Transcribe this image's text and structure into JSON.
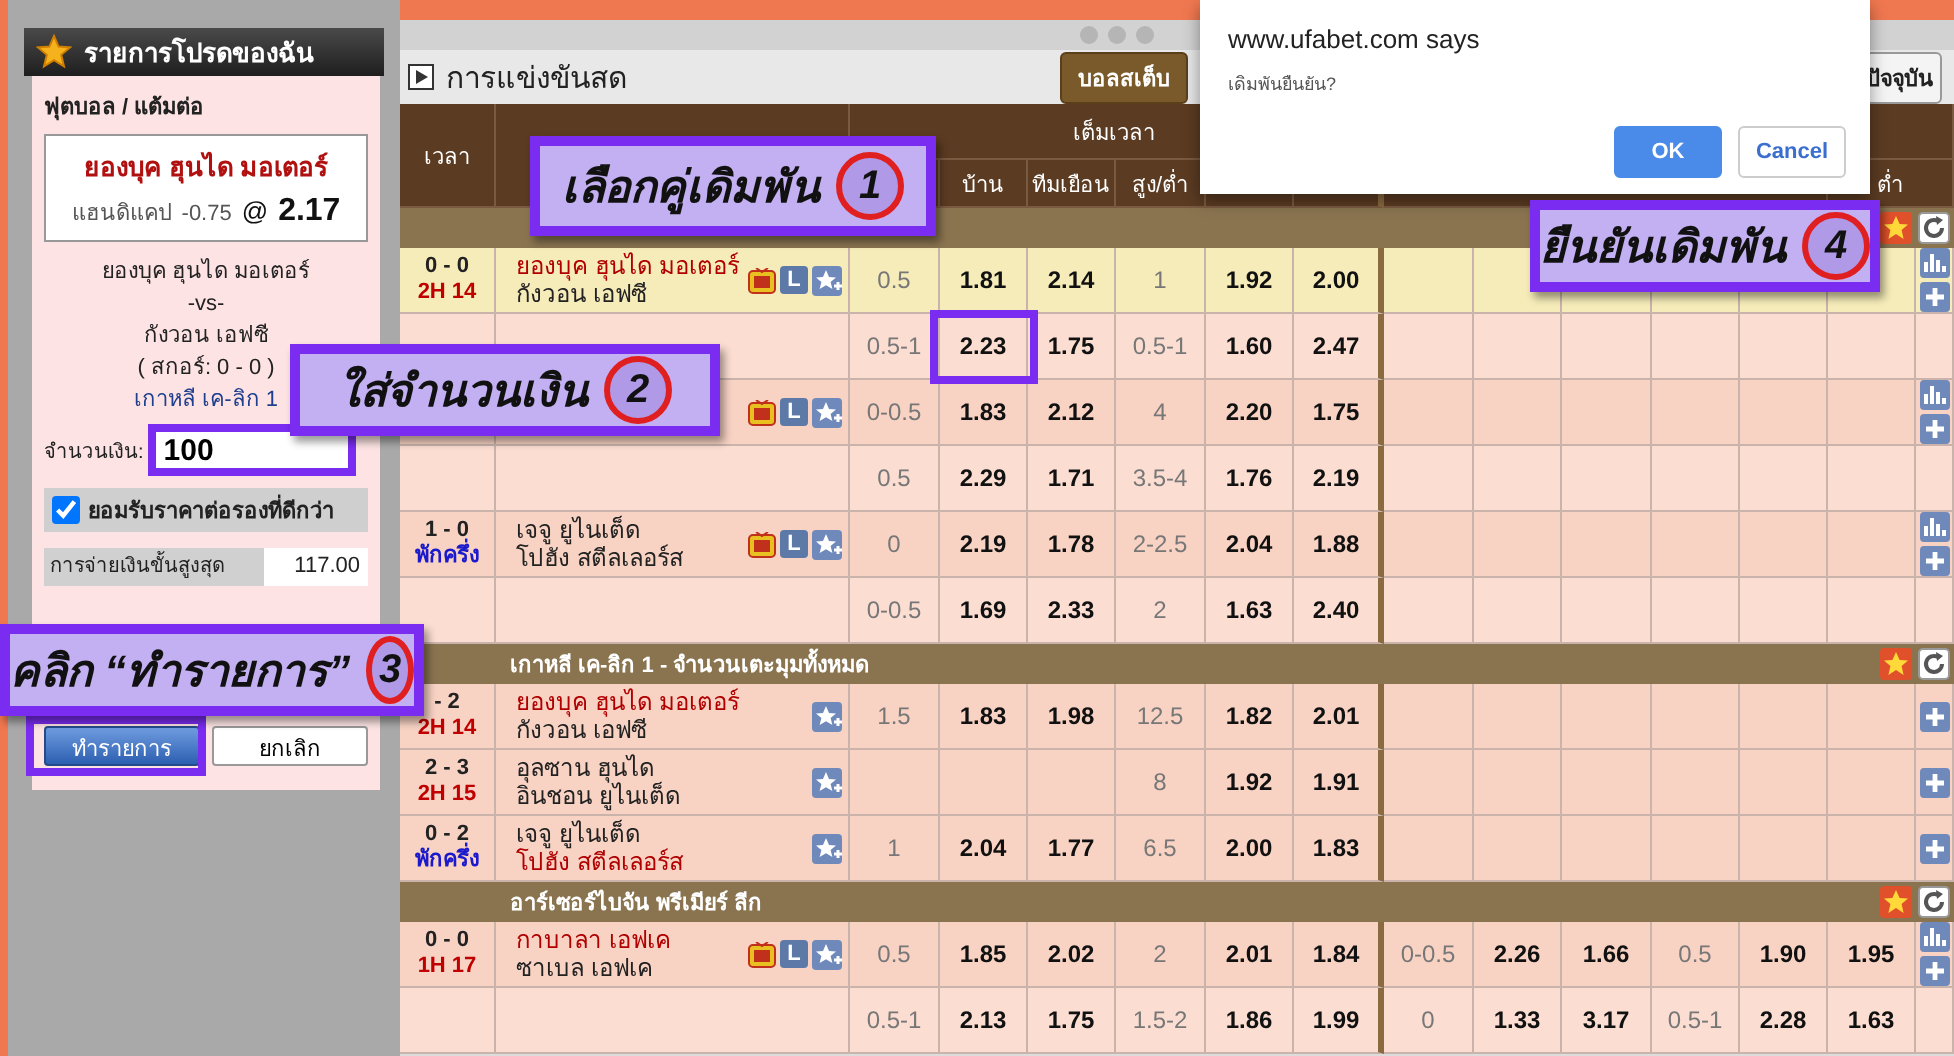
{
  "window": {
    "title": "การแข่งขันสด",
    "buttons": [
      {
        "label": "บอลสเต็บ",
        "kind": "dark"
      },
      {
        "label": "ปัจจุบัน",
        "kind": "light"
      }
    ]
  },
  "favorites": {
    "title": "รายการโปรดของฉัน",
    "sport": "ฟุตบอล / แต้มต่อ",
    "pick": {
      "team": "ยองบุค ฮุนได มอเตอร์",
      "market": "แฮนดิแคป",
      "line": "-0.75",
      "at": "@",
      "odds": "2.17"
    },
    "match_lines": [
      {
        "text": "ยองบุค ฮุนได มอเตอร์",
        "kind": "plain"
      },
      {
        "text": "-vs-",
        "kind": "plain"
      },
      {
        "text": "กังวอน เอฟซี",
        "kind": "plain"
      },
      {
        "text": "( สกอร์: 0 - 0 )",
        "kind": "plain"
      },
      {
        "text": "เกาหลี เค-ลิก 1",
        "kind": "league"
      }
    ],
    "amount": {
      "label": "จำนวนเงิน:",
      "value": "100"
    },
    "accept_better_odds": {
      "label": "ยอมรับราคาต่อรองที่ดีกว่า",
      "checked": true
    },
    "max_payout": {
      "label": "การจ่ายเงินขั้นสูงสุด",
      "value": "117.00"
    },
    "buttons": [
      {
        "label": "ทำรายการ",
        "kind": "primary"
      },
      {
        "label": "ยกเลิก",
        "kind": "secondary"
      }
    ]
  },
  "table": {
    "time_header": "เวลา",
    "full_time_header": "เต็มเวลา",
    "full_time_subheaders": [
      "บ้าน",
      "ทีมเยือน",
      "สูง/ต่ำ"
    ],
    "first_half_subheaders": [
      "ต่ำ"
    ],
    "groups": [
      {
        "matches": [
          {
            "score": "0 - 0",
            "period": {
              "text": "2H 14",
              "color": "#c00000"
            },
            "highlighted": true,
            "teams": [
              {
                "name": "ยองบุค ฮุนได มอเตอร์",
                "favored": true
              },
              {
                "name": "กังวอน เอฟซี",
                "favored": false
              }
            ],
            "icons": [
              {
                "kind": "tv"
              },
              {
                "kind": "live",
                "label": "L"
              },
              {
                "kind": "favorite"
              }
            ],
            "actions": [
              {
                "kind": "chart"
              },
              {
                "kind": "plus"
              }
            ],
            "lines": [
              {
                "handicap": [
                  "0.5",
                  "1.81",
                  "2.14"
                ],
                "over_under": [
                  "1",
                  "1.92",
                  "2.00"
                ]
              },
              {
                "handicap": [
                  "0.5-1",
                  "2.23",
                  "1.75"
                ],
                "over_under": [
                  "0.5-1",
                  "1.60",
                  "2.47"
                ]
              }
            ]
          },
          {
            "highlighted": false,
            "icons": [
              {
                "kind": "tv"
              },
              {
                "kind": "live",
                "label": "L"
              },
              {
                "kind": "favorite"
              }
            ],
            "actions": [
              {
                "kind": "chart"
              },
              {
                "kind": "plus"
              }
            ],
            "lines": [
              {
                "handicap": [
                  "0-0.5",
                  "1.83",
                  "2.12"
                ],
                "over_under": [
                  "4",
                  "2.20",
                  "1.75"
                ]
              },
              {
                "handicap": [
                  "0.5",
                  "2.29",
                  "1.71"
                ],
                "over_under": [
                  "3.5-4",
                  "1.76",
                  "2.19"
                ]
              }
            ]
          },
          {
            "score": "1 - 0",
            "period": {
              "text": "พักครึ่ง",
              "color": "#1a1acc"
            },
            "highlighted": false,
            "teams": [
              {
                "name": "เจจู ยูไนเต็ด",
                "favored": false
              },
              {
                "name": "โปฮัง สตีลเลอร์ส",
                "favored": false
              }
            ],
            "icons": [
              {
                "kind": "tv"
              },
              {
                "kind": "live",
                "label": "L"
              },
              {
                "kind": "favorite"
              }
            ],
            "actions": [
              {
                "kind": "chart"
              },
              {
                "kind": "plus"
              }
            ],
            "lines": [
              {
                "handicap": [
                  "0",
                  "2.19",
                  "1.78"
                ],
                "over_under": [
                  "2-2.5",
                  "2.04",
                  "1.88"
                ]
              },
              {
                "handicap": [
                  "0-0.5",
                  "1.69",
                  "2.33"
                ],
                "over_under": [
                  "2",
                  "1.63",
                  "2.40"
                ]
              }
            ]
          }
        ]
      },
      {
        "league": "เกาหลี เค-ลิก 1 - จำนวนเตะมุมทั้งหมด",
        "matches": [
          {
            "score": "- 2",
            "period": {
              "text": "2H 14",
              "color": "#c00000"
            },
            "highlighted": false,
            "teams": [
              {
                "name": "ยองบุค ฮุนได มอเตอร์",
                "favored": true
              },
              {
                "name": "กังวอน เอฟซี",
                "favored": false
              }
            ],
            "icons": [
              {
                "kind": "favorite"
              }
            ],
            "actions": [
              {
                "kind": "plus"
              }
            ],
            "lines": [
              {
                "handicap": [
                  "1.5",
                  "1.83",
                  "1.98"
                ],
                "over_under": [
                  "12.5",
                  "1.82",
                  "2.01"
                ]
              }
            ]
          },
          {
            "score": "2 - 3",
            "period": {
              "text": "2H 15",
              "color": "#c00000"
            },
            "highlighted": false,
            "teams": [
              {
                "name": "อุลซาน ฮุนได",
                "favored": false
              },
              {
                "name": "อินชอน ยูไนเต็ด",
                "favored": false
              }
            ],
            "icons": [
              {
                "kind": "favorite"
              }
            ],
            "actions": [
              {
                "kind": "plus"
              }
            ],
            "lines": [
              {
                "over_under": [
                  "8",
                  "1.92",
                  "1.91"
                ]
              }
            ]
          },
          {
            "score": "0 - 2",
            "period": {
              "text": "พักครึ่ง",
              "color": "#1a1acc"
            },
            "highlighted": false,
            "teams": [
              {
                "name": "เจจู ยูไนเต็ด",
                "favored": false
              },
              {
                "name": "โปฮัง สตีลเลอร์ส",
                "favored": true
              }
            ],
            "icons": [
              {
                "kind": "favorite"
              }
            ],
            "actions": [
              {
                "kind": "plus"
              }
            ],
            "lines": [
              {
                "handicap": [
                  "1",
                  "2.04",
                  "1.77"
                ],
                "over_under": [
                  "6.5",
                  "2.00",
                  "1.83"
                ]
              }
            ]
          }
        ]
      },
      {
        "league": "อาร์เซอร์ไบจัน พรีเมียร์ ลีก",
        "matches": [
          {
            "score": "0 - 0",
            "period": {
              "text": "1H 17",
              "color": "#c00000"
            },
            "highlighted": false,
            "teams": [
              {
                "name": "กาบาลา เอฟเค",
                "favored": true
              },
              {
                "name": "ซาเบล เอฟเค",
                "favored": false
              }
            ],
            "icons": [
              {
                "kind": "tv"
              },
              {
                "kind": "live",
                "label": "L"
              },
              {
                "kind": "favorite"
              }
            ],
            "actions": [
              {
                "kind": "chart"
              },
              {
                "kind": "plus"
              }
            ],
            "lines": [
              {
                "handicap": [
                  "0.5",
                  "1.85",
                  "2.02"
                ],
                "over_under": [
                  "2",
                  "2.01",
                  "1.84"
                ],
                "first_half_handicap": [
                  "0-0.5",
                  "2.26",
                  "1.66"
                ],
                "first_half_over_under": [
                  "0.5",
                  "1.90",
                  "1.95"
                ]
              },
              {
                "handicap": [
                  "0.5-1",
                  "2.13",
                  "1.75"
                ],
                "over_under": [
                  "1.5-2",
                  "1.86",
                  "1.99"
                ],
                "first_half_handicap": [
                  "0",
                  "1.33",
                  "3.17"
                ],
                "first_half_over_under": [
                  "0.5-1",
                  "2.28",
                  "1.63"
                ]
              }
            ]
          }
        ]
      }
    ]
  },
  "dialog": {
    "origin": "www.ufabet.com says",
    "message": "เดิมพันยืนยัน?",
    "buttons": [
      {
        "label": "OK",
        "kind": "primary"
      },
      {
        "label": "Cancel",
        "kind": "secondary"
      }
    ]
  },
  "annotations": [
    {
      "text": "เลือกคู่เดิมพัน",
      "number": "1"
    },
    {
      "text": "ใส่จำนวนเงิน",
      "number": "2"
    },
    {
      "text": "คลิก “ทำรายการ”",
      "number": "3"
    },
    {
      "text": "ยืนยันเดิมพัน",
      "number": "4"
    }
  ]
}
